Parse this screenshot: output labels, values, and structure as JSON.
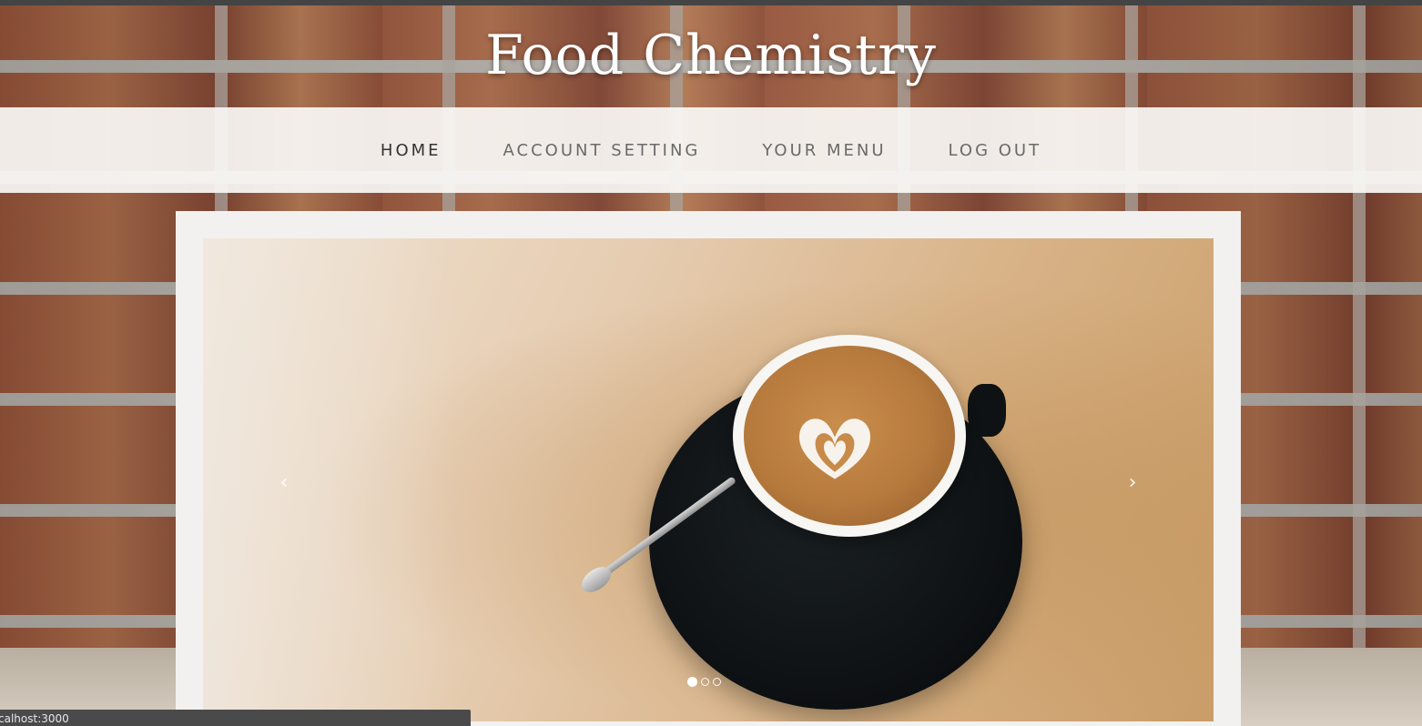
{
  "site": {
    "title": "Food Chemistry"
  },
  "nav": {
    "items": [
      {
        "label": "HOME",
        "active": true
      },
      {
        "label": "ACCOUNT SETTING",
        "active": false
      },
      {
        "label": "YOUR MENU",
        "active": false
      },
      {
        "label": "LOG OUT",
        "active": false
      }
    ]
  },
  "carousel": {
    "prev_label": "‹",
    "next_label": "›",
    "slide_count": 3,
    "active_index": 0,
    "image": "latte-coffee-cup-image"
  },
  "status_bar": {
    "text": "calhost:3000"
  },
  "colors": {
    "nav_background": "#f8f6f4",
    "card_background": "#f3f1ef",
    "title_color": "#ffffff",
    "nav_text": "#6a6a6a",
    "nav_active_text": "#333333",
    "status_bar_background": "#4a4a4a"
  }
}
